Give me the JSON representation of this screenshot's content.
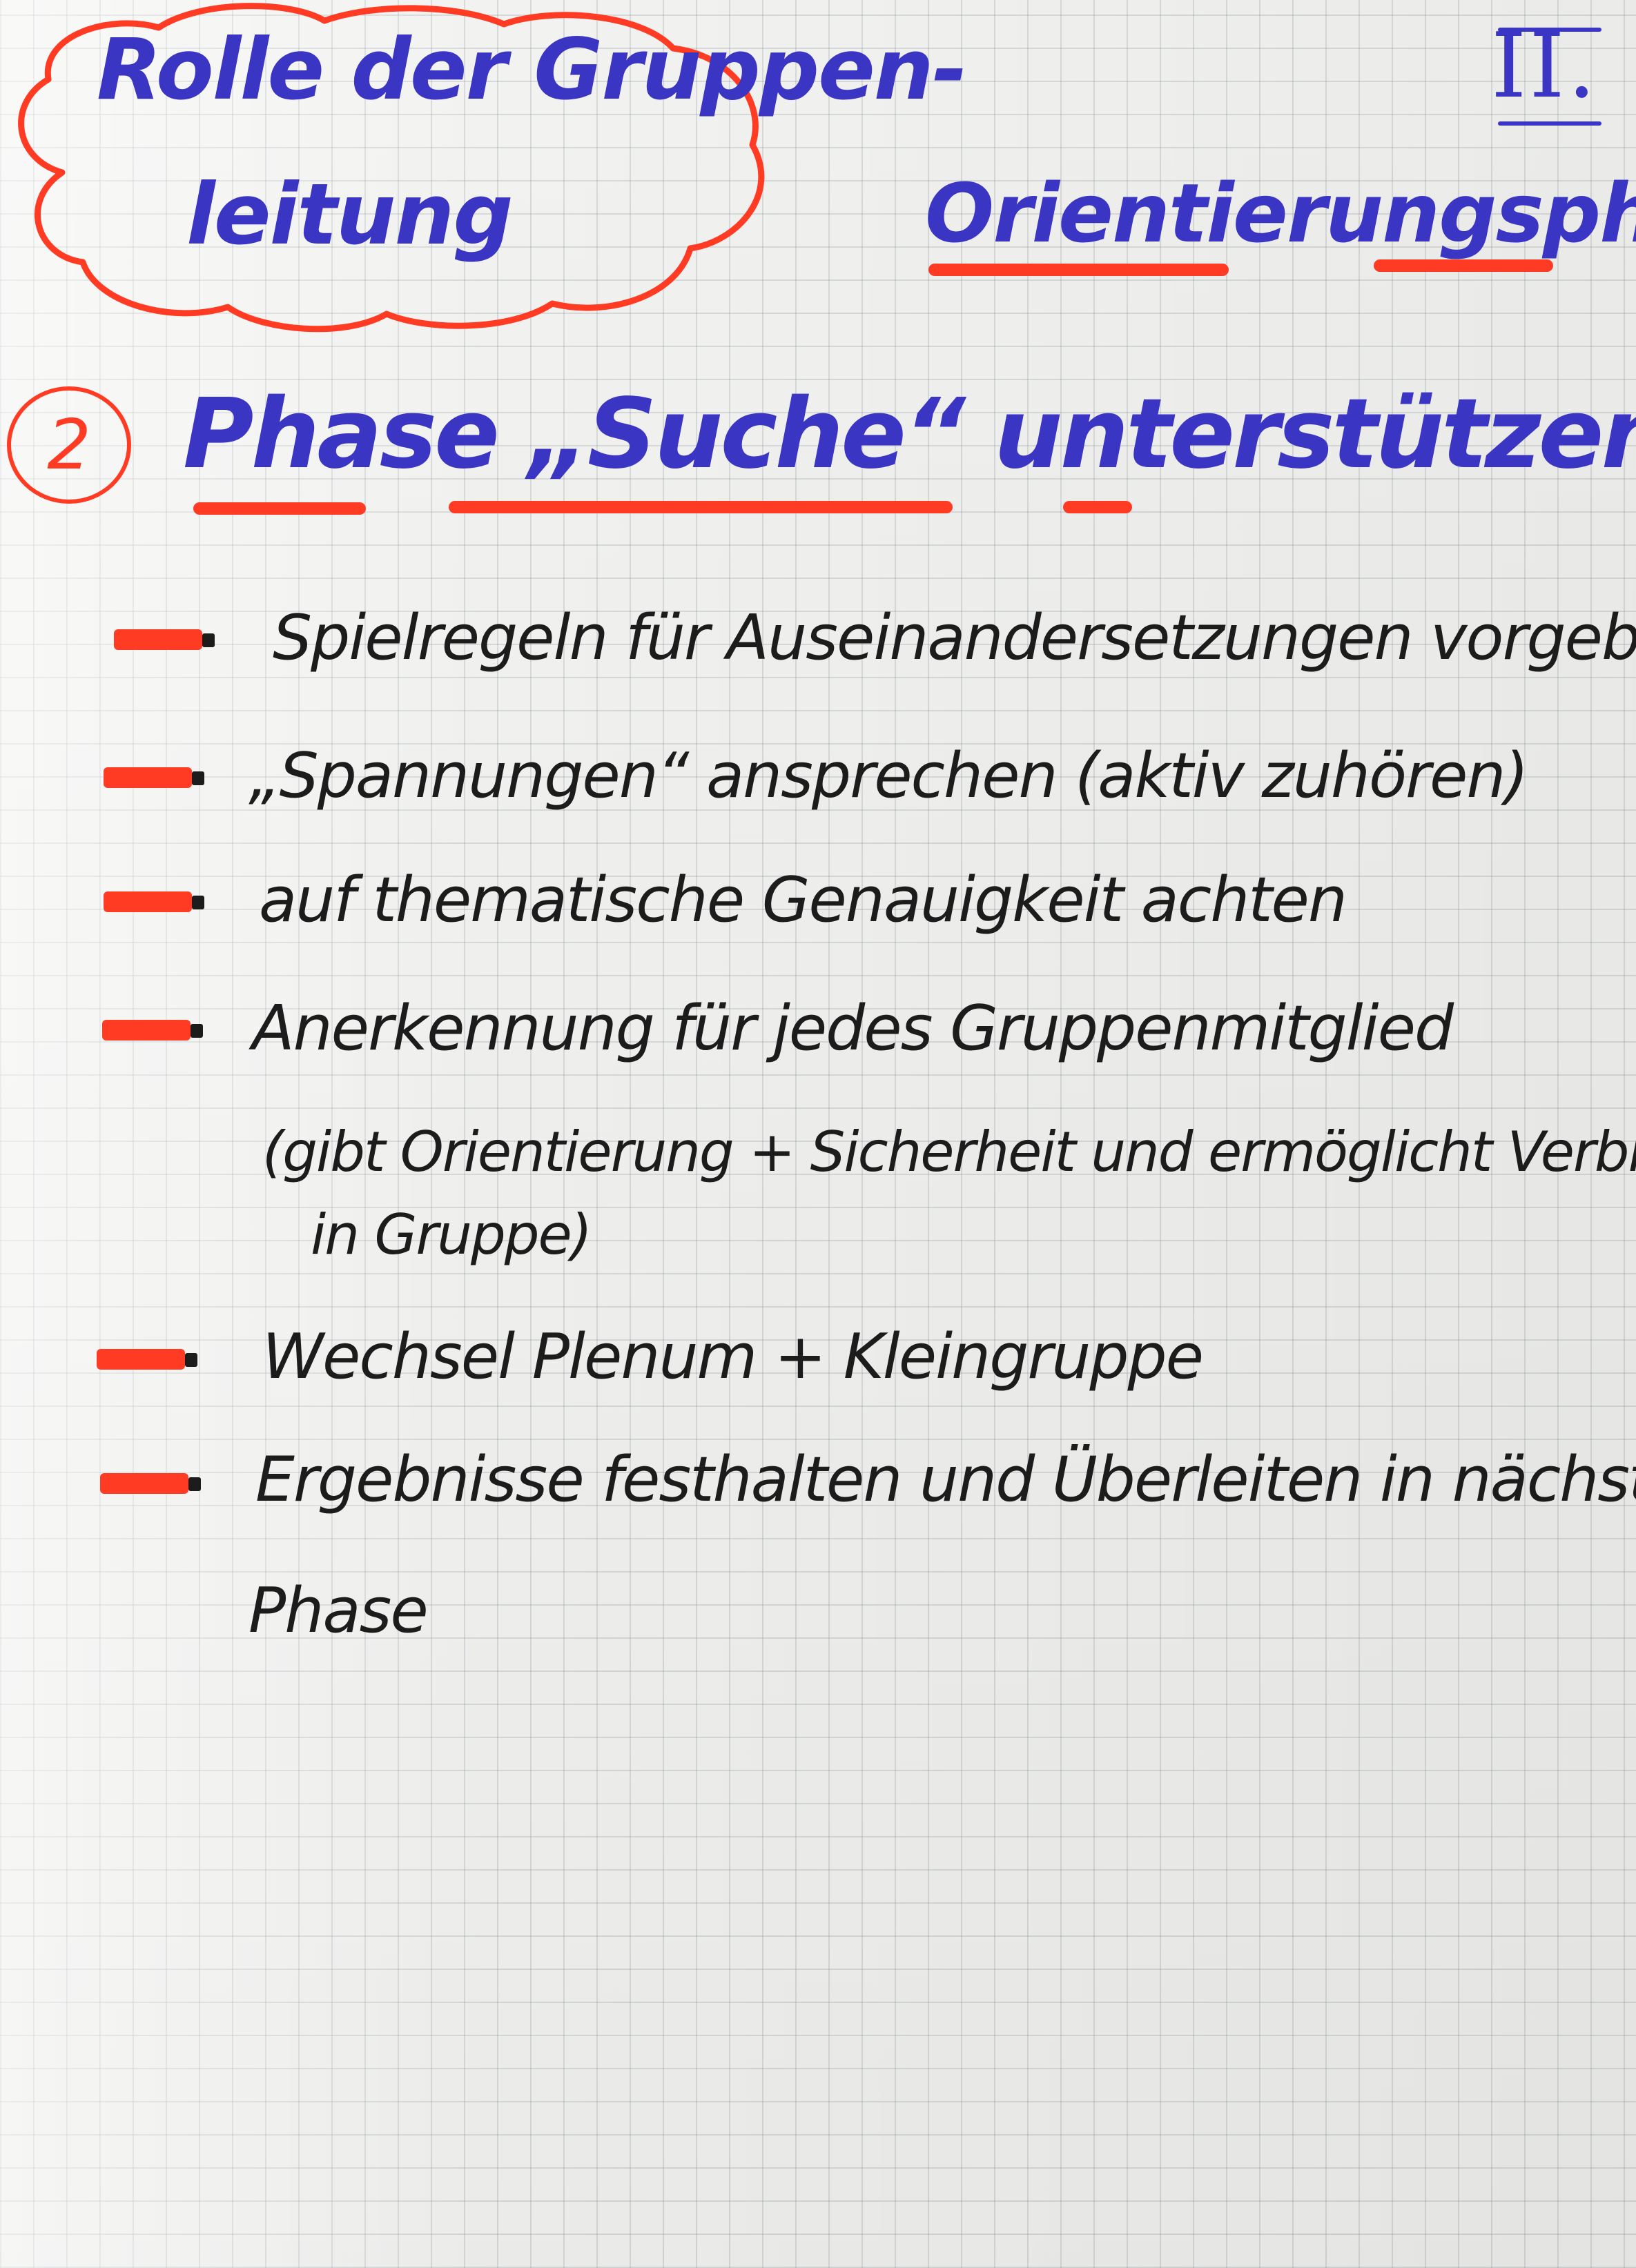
{
  "header": {
    "cloud_title_line1": "Rolle der Gruppen-",
    "cloud_title_line2": "leitung",
    "roman_numeral": "II.",
    "phase_name": "Orientierungsphase"
  },
  "colors": {
    "ink_blue": "#3b35c4",
    "marker_red": "#ff3b24",
    "ink_black": "#1c1c1c"
  },
  "step": {
    "number": "2",
    "heading": "Phase „Suche“ unterstützen"
  },
  "items": [
    {
      "text": "Spielregeln für Auseinandersetzungen vorgeben (Feedb"
    },
    {
      "text": "„Spannungen“ ansprechen   (aktiv zuhören)"
    },
    {
      "text": "auf thematische Genauigkeit achten"
    },
    {
      "text": "Anerkennung für jedes Gruppenmitglied"
    },
    {
      "text": "Wechsel Plenum + Kleingruppe"
    },
    {
      "text": "Ergebnisse festhalten und Überleiten in nächste"
    }
  ],
  "notes": {
    "anerkennung_line1": "(gibt Orientierung + Sicherheit und ermöglicht Verbleib",
    "anerkennung_line2": "in Gruppe)",
    "ergebnisse_line2": "Phase"
  }
}
